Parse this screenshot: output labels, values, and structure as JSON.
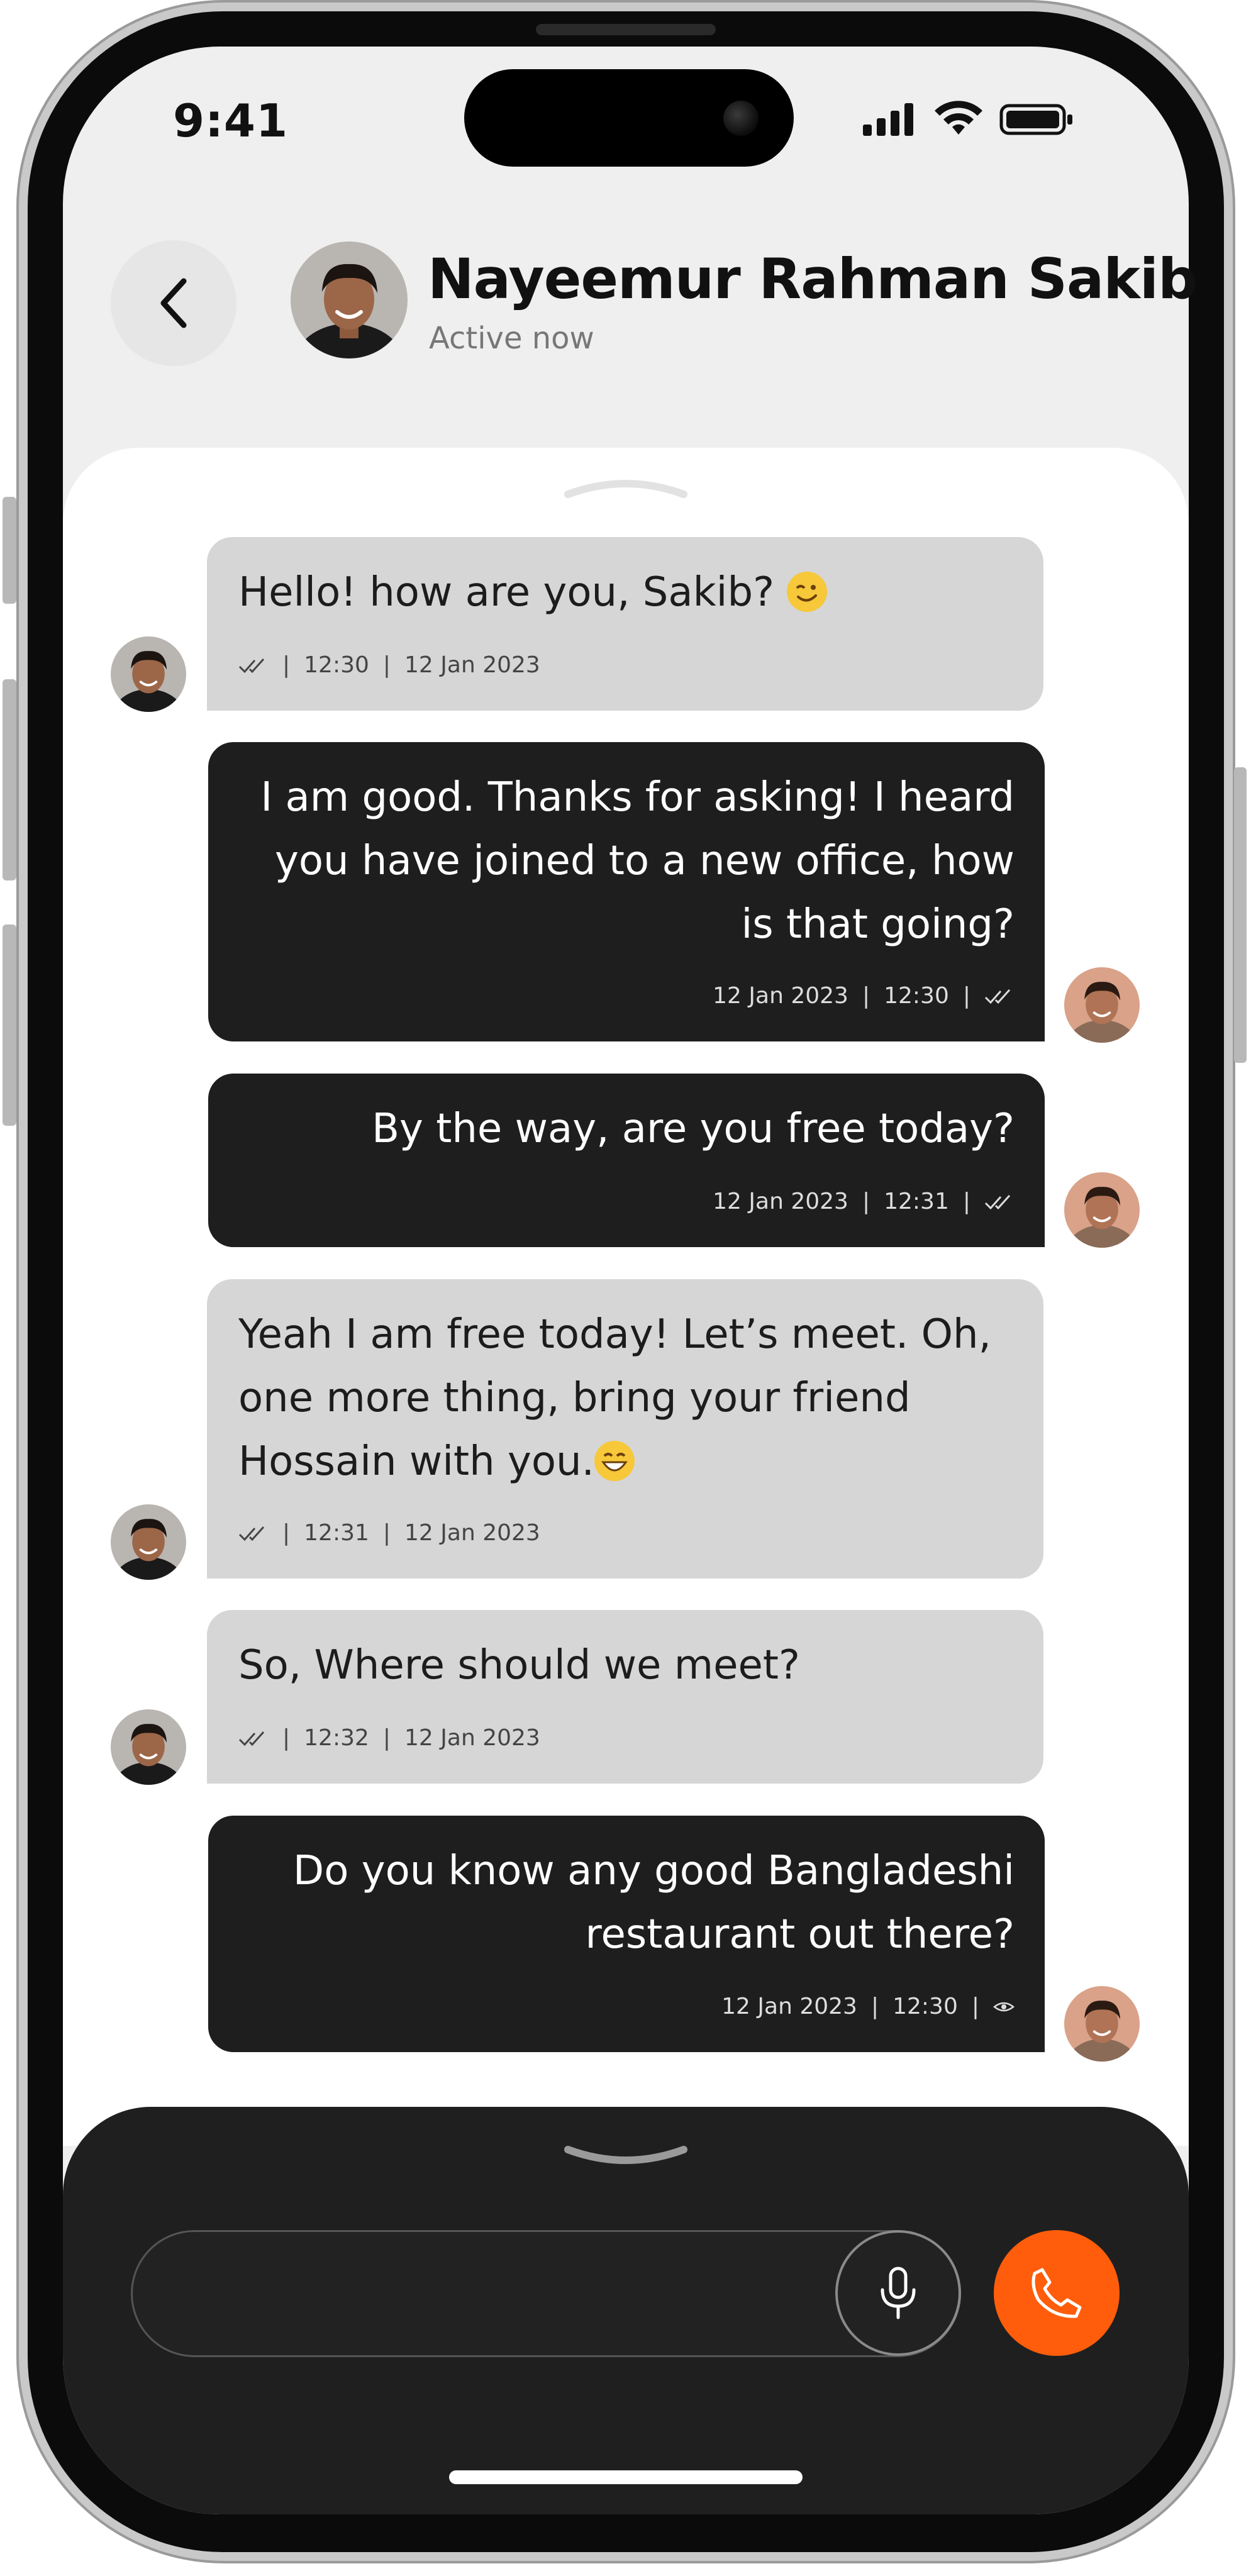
{
  "status_bar": {
    "time": "9:41"
  },
  "header": {
    "contact_name": "Nayeemur Rahman Sakib",
    "contact_status": "Active now"
  },
  "messages": [
    {
      "direction": "incoming",
      "text": "Hello! how are you, Sakib?",
      "emoji": "winking-face",
      "status_icon": "double-check",
      "time": "12:30",
      "date": "12 Jan 2023"
    },
    {
      "direction": "outgoing",
      "text": "I am good. Thanks for asking! I heard you have joined to a new office, how is that going?",
      "date": "12 Jan 2023",
      "time": "12:30",
      "status_icon": "double-check"
    },
    {
      "direction": "outgoing",
      "text": "By the way, are you free today?",
      "date": "12 Jan 2023",
      "time": "12:31",
      "status_icon": "double-check"
    },
    {
      "direction": "incoming",
      "text": "Yeah I am free today! Let’s meet. Oh, one more thing, bring your friend Hossain with you.",
      "emoji": "grinning-face",
      "status_icon": "double-check",
      "time": "12:31",
      "date": "12 Jan 2023"
    },
    {
      "direction": "incoming",
      "text": "So, Where should we meet?",
      "status_icon": "double-check",
      "time": "12:32",
      "date": "12 Jan 2023"
    },
    {
      "direction": "outgoing",
      "text": "Do you know any good Bangladeshi restaurant out there?",
      "date": "12 Jan 2023",
      "time": "12:30",
      "status_icon": "eye-seen"
    }
  ],
  "composer": {
    "input_value": "",
    "mic_icon": "microphone-icon",
    "call_icon": "phone-icon"
  },
  "colors": {
    "accent": "#ff5d0b",
    "incoming_bubble": "#d6d6d6",
    "outgoing_bubble": "#1e1e1e",
    "composer_bg": "#1f1f1f"
  }
}
